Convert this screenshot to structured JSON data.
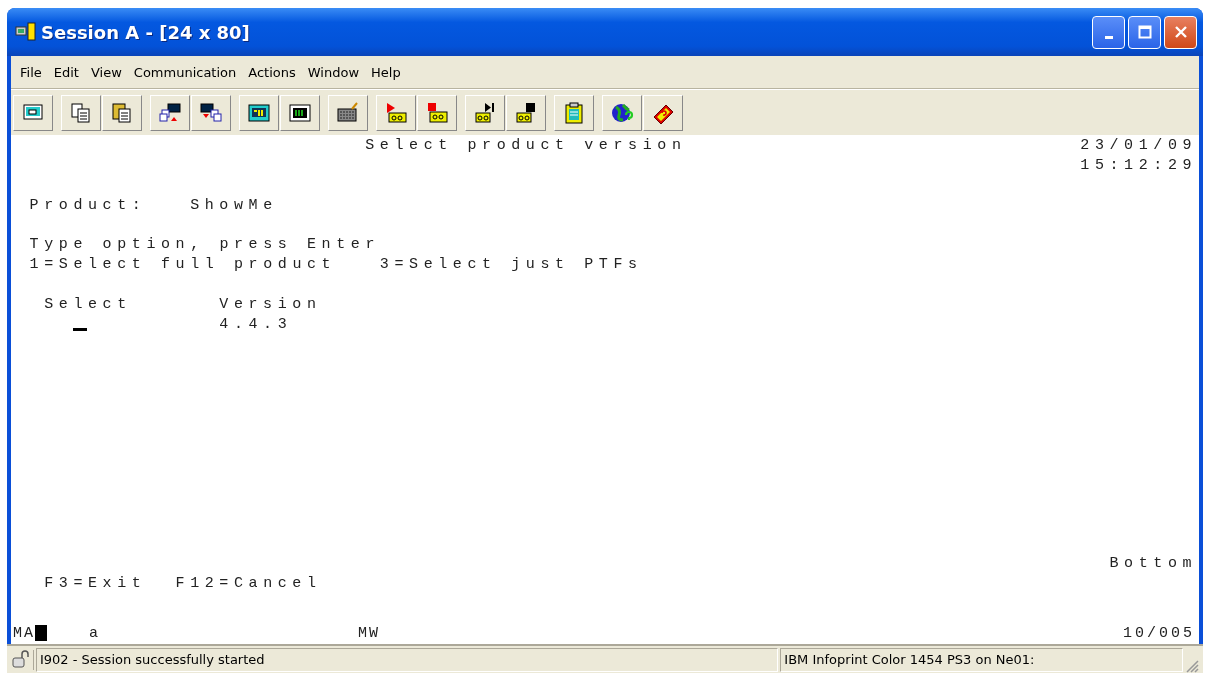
{
  "window": {
    "title": "Session A - [24 x 80]"
  },
  "menu": [
    "File",
    "Edit",
    "View",
    "Communication",
    "Actions",
    "Window",
    "Help"
  ],
  "screen": {
    "title": "Select product version",
    "date": "23/01/09",
    "time": "15:12:29",
    "product_label": "Product:",
    "product_value": "ShowMe",
    "instruction": "Type option, press Enter",
    "options": [
      "1=Select full product",
      "3=Select just PTFs"
    ],
    "columns": [
      "Select",
      "Version"
    ],
    "rows": [
      {
        "version": "4.4.3",
        "cursor": true
      }
    ],
    "more": "Bottom",
    "function_keys": [
      "F3=Exit",
      "F12=Cancel"
    ]
  },
  "oia": {
    "status": "MA",
    "shift": "a",
    "mode": "MW",
    "position": "10/005"
  },
  "status_bar": {
    "message": "I902 - Session successfully started",
    "printer": "IBM Infoprint Color 1454 PS3 on Ne01:"
  }
}
